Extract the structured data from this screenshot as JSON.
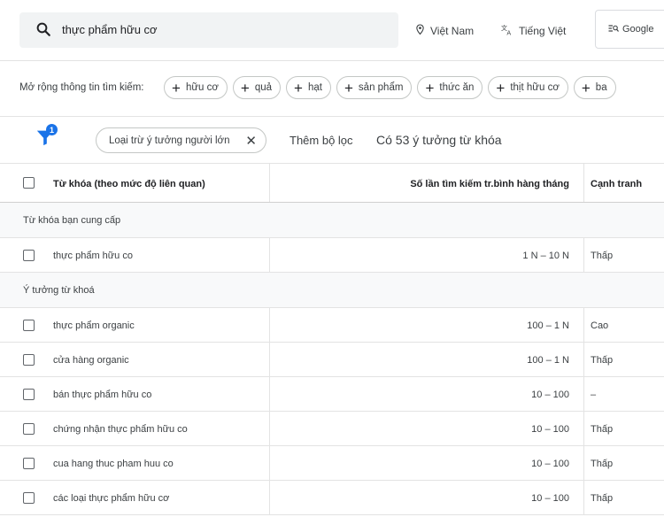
{
  "header": {
    "search_query": "thực phẩm hữu cơ",
    "location": "Việt Nam",
    "language": "Tiếng Việt",
    "search_engine": "Google"
  },
  "refine": {
    "label": "Mở rộng thông tin tìm kiếm:",
    "chips": [
      "hữu cơ",
      "quả",
      "hạt",
      "sản phẩm",
      "thức ăn",
      "thịt hữu cơ",
      "ba"
    ]
  },
  "filters": {
    "badge_count": "1",
    "active_filter": "Loại trừ ý tưởng người lớn",
    "add_filter": "Thêm bộ lọc",
    "result_count": "Có 53 ý tưởng từ khóa"
  },
  "table": {
    "columns": {
      "keyword": "Từ khóa (theo mức độ liên quan)",
      "volume": "Số lần tìm kiếm tr.bình hàng tháng",
      "competition": "Cạnh tranh"
    },
    "provided_group": "Từ khóa bạn cung cấp",
    "provided_rows": [
      {
        "keyword": "thực phẩm hữu co",
        "volume": "1 N – 10 N",
        "competition": "Thấp"
      }
    ],
    "ideas_group": "Ý tưởng từ khoá",
    "idea_rows": [
      {
        "keyword": "thực phẩm organic",
        "volume": "100 – 1 N",
        "competition": "Cao"
      },
      {
        "keyword": "cửa hàng organic",
        "volume": "100 – 1 N",
        "competition": "Thấp"
      },
      {
        "keyword": "bán thực phẩm hữu co",
        "volume": "10 – 100",
        "competition": "–"
      },
      {
        "keyword": "chứng nhận thực phẩm hữu co",
        "volume": "10 – 100",
        "competition": "Thấp"
      },
      {
        "keyword": "cua hang thuc pham huu co",
        "volume": "10 – 100",
        "competition": "Thấp"
      },
      {
        "keyword": "các loại thực phẩm hữu cơ",
        "volume": "10 – 100",
        "competition": "Thấp"
      }
    ]
  },
  "colors": {
    "accent": "#1a73e8",
    "chip_border": "#c4c7c5"
  }
}
